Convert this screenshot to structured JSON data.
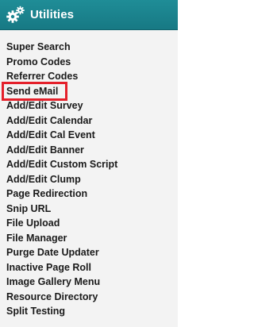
{
  "header": {
    "title": "Utilities",
    "icon": "gears-icon"
  },
  "menu": {
    "items": [
      {
        "label": "Super Search"
      },
      {
        "label": "Promo Codes"
      },
      {
        "label": "Referrer Codes"
      },
      {
        "label": "Send eMail"
      },
      {
        "label": "Add/Edit Survey"
      },
      {
        "label": "Add/Edit Calendar"
      },
      {
        "label": "Add/Edit Cal Event"
      },
      {
        "label": "Add/Edit Banner"
      },
      {
        "label": "Add/Edit Custom Script"
      },
      {
        "label": "Add/Edit Clump"
      },
      {
        "label": "Page Redirection"
      },
      {
        "label": "Snip URL"
      },
      {
        "label": "File Upload"
      },
      {
        "label": "File Manager"
      },
      {
        "label": "Purge Date Updater"
      },
      {
        "label": "Inactive Page Roll"
      },
      {
        "label": "Image Gallery Menu"
      },
      {
        "label": "Resource Directory"
      },
      {
        "label": "Split Testing"
      }
    ],
    "highlighted_item": "Send eMail"
  },
  "colors": {
    "header_bg": "#1a8490",
    "highlight_border": "#e4202b",
    "panel_bg": "#f3f3f3"
  }
}
